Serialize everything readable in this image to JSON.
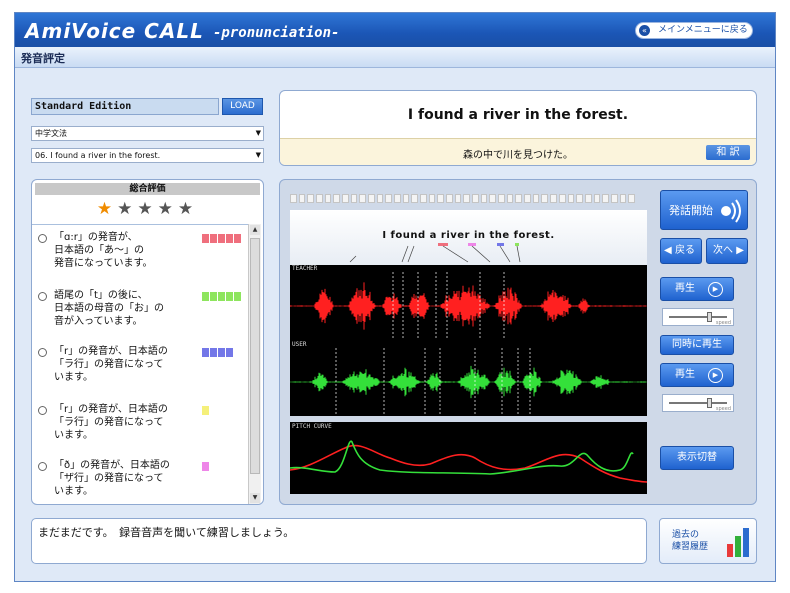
{
  "app": {
    "title": "AmiVoice CALL",
    "subtitle": "-pronunciation-",
    "main_menu_button": "メインメニューに戻る"
  },
  "section": {
    "title": "発音評定"
  },
  "sidebar": {
    "edition": "Standard Edition",
    "load_button": "LOAD",
    "category_select": "中学文法",
    "sentence_select": "06. I found a river in the forest."
  },
  "sentence": {
    "english": "I found a river in the forest.",
    "japanese": "森の中で川を見つけた。",
    "translate_button": "和 訳"
  },
  "evaluation": {
    "title": "総合評価",
    "rating": 1,
    "max_rating": 5,
    "items": [
      {
        "text": "「ɑ:r」の発音が、\n日本語の「あ～」の\n発音になっています。",
        "color": "#ef6f7d",
        "blocks": 5
      },
      {
        "text": "語尾の「t」の後に、\n日本語の母音の「お」の\n音が入っています。",
        "color": "#8ee55e",
        "blocks": 5
      },
      {
        "text": "「r」の発音が、日本語の\n「ラ行」の発音になって\nいます。",
        "color": "#7377e8",
        "blocks": 4
      },
      {
        "text": "「r」の発音が、日本語の\n「ラ行」の発音になって\nいます。",
        "color": "#f5f07a",
        "blocks": 1
      },
      {
        "text": "「ð」の発音が、日本語の\n「ザ行」の発音になって\nいます。",
        "color": "#ee86e8",
        "blocks": 1
      }
    ]
  },
  "waveform": {
    "sentence": "I found a river in the forest.",
    "teacher_label": "TEACHER",
    "user_label": "USER",
    "pitch_label": "PITCH CURVE",
    "teacher_color": "#ff2020",
    "user_color": "#34e03a"
  },
  "controls": {
    "start_button": "発話開始",
    "back_button": "戻る",
    "next_button": "次へ",
    "play_teacher_button": "再生",
    "simul_play_button": "同時に再生",
    "play_user_button": "再生",
    "toggle_display_button": "表示切替",
    "speed_label": "speed"
  },
  "message": "まだまだです。　録音音声を聞いて練習しましょう。",
  "history_button": "過去の\n練習履歴"
}
